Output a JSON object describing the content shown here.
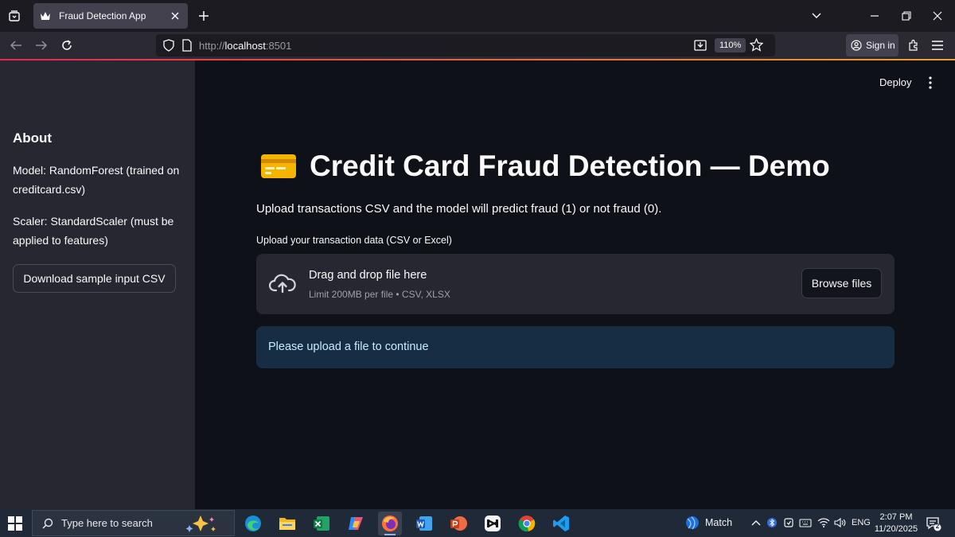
{
  "browser": {
    "tab_title": "Fraud Detection App",
    "url_scheme": "http://",
    "url_host": "localhost",
    "url_port": ":8501",
    "zoom": "110%",
    "signin_label": "Sign in"
  },
  "sidebar": {
    "heading": "About",
    "model_text": "Model: RandomForest (trained on creditcard.csv)",
    "scaler_text": "Scaler: StandardScaler (must be applied to features)",
    "download_button": "Download sample input CSV"
  },
  "header": {
    "deploy_label": "Deploy"
  },
  "main": {
    "title": "Credit Card Fraud Detection — Demo",
    "subtitle": "Upload transactions CSV and the model will predict fraud (1) or not fraud (0).",
    "uploader_label": "Upload your transaction data (CSV or Excel)",
    "dropzone_text": "Drag and drop file here",
    "dropzone_limits": "Limit 200MB per file • CSV, XLSX",
    "browse_button": "Browse files",
    "info_message": "Please upload a file to continue"
  },
  "taskbar": {
    "search_placeholder": "Type here to search",
    "weather_label": "Match",
    "language": "ENG",
    "time": "2:07 PM",
    "date": "11/20/2025",
    "notification_count": "2"
  },
  "colors": {
    "app_background": "#0e1117",
    "sidebar_background": "#262730",
    "info_background": "#172d43",
    "info_text": "#c7ebff"
  }
}
